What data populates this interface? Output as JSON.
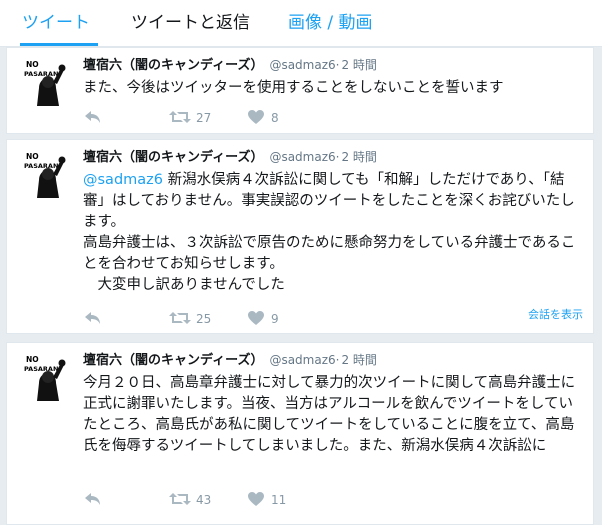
{
  "tabs": {
    "tweets": "ツイート",
    "tweets_replies": "ツイートと返信",
    "media": "画像 / 動画"
  },
  "avatar_text": "NO PASARAN",
  "tweets": [
    {
      "name": "壇宿六（闇のキャンディーズ）",
      "handle": "@sadmaz6",
      "separator": "·",
      "time": "2 時間",
      "mention": "",
      "text": "また、今後はツイッターを使用することをしないことを誓います",
      "retweets": "27",
      "likes": "8"
    },
    {
      "name": "壇宿六（闇のキャンディーズ）",
      "handle": "@sadmaz6",
      "separator": "·",
      "time": "2 時間",
      "mention": "@sadmaz6",
      "text": " 新潟水俣病４次訴訟に関しても「和解」しただけであり、「結審」はしておりません。事実誤認のツイートをしたことを深くお詫びいたします。\n高島弁護士は、３次訴訟で原告のために懸命努力をしている弁護士であることを合わせてお知らせします。\n　大変申し訳ありませんでした",
      "retweets": "25",
      "likes": "9",
      "conversation": "会話を表示"
    },
    {
      "name": "壇宿六（闇のキャンディーズ）",
      "handle": "@sadmaz6",
      "separator": "·",
      "time": "2 時間",
      "mention": "",
      "text": "今月２０日、高島章弁護士に対して暴力的次ツイートに関して高島弁護士に正式に謝罪いたします。当夜、当方はアルコールを飲んでツイートをしていたところ、高島氏があ私に関してツイートをしていることに腹を立て、高島氏を侮辱するツイートしてしまいました。また、新潟水俣病４次訴訟に",
      "retweets": "43",
      "likes": "11"
    }
  ],
  "colors": {
    "accent": "#1da1f2",
    "background": "#e6ecf0",
    "muted": "#8899a6"
  },
  "icons": [
    "reply-icon",
    "retweet-icon",
    "heart-icon"
  ]
}
